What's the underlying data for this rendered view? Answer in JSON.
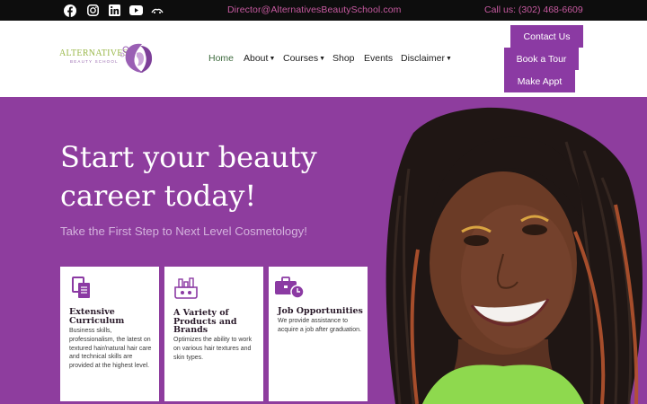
{
  "topbar": {
    "social_icons": [
      "facebook-icon",
      "instagram-icon",
      "linkedin-icon",
      "youtube-icon",
      "yelp-icon"
    ],
    "email": "Director@AlternativesBeautySchool.com",
    "phone": "Call us: (302) 468-6609"
  },
  "header": {
    "logo_text": "ALTERNATIVES",
    "logo_subtext": "BEAUTY SCHOOL",
    "nav": [
      {
        "label": "Home",
        "active": true
      },
      {
        "label": "About",
        "dropdown": true
      },
      {
        "label": "Courses",
        "dropdown": true
      },
      {
        "label": "Shop"
      },
      {
        "label": "Events"
      },
      {
        "label": "Disclaimer",
        "dropdown": true
      }
    ],
    "buttons": [
      "Contact Us",
      "Book a Tour",
      "Make Appt"
    ]
  },
  "hero": {
    "title": "Start your beauty career today!",
    "subtitle": "Take the First Step to Next Level Cosmetology!",
    "cards": [
      {
        "icon": "documents-icon",
        "title_lines": [
          "Extensive",
          "Curriculum"
        ],
        "body": "Business skills, professionalism, the latest on textured hair/natural hair care and technical skills are provided at the highest level."
      },
      {
        "icon": "beauty-products-icon",
        "title_lines": [
          "A Variety of",
          "Products and",
          "Brands"
        ],
        "body": "Optimizes the ability to work on various hair textures and skin types."
      },
      {
        "icon": "briefcase-clock-icon",
        "title_lines": [
          "Job Opportunities"
        ],
        "body": "We provide assistance to acquire a job after graduation."
      }
    ]
  },
  "colors": {
    "brand_purple": "#8e3d9e",
    "button_purple": "#8b3aa3",
    "topbar_text": "#c75aa0",
    "active_nav": "#3e6b3e"
  }
}
